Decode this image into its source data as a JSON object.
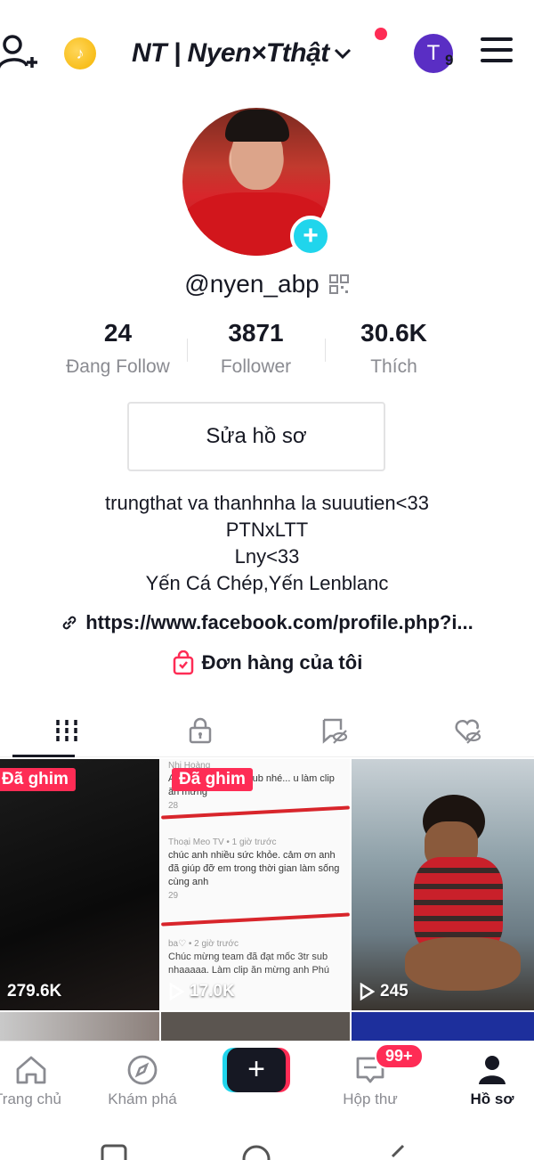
{
  "topbar": {
    "account_name": "NT | Nyen×Tthật",
    "avatar_initial": "T",
    "avatar_count": "9"
  },
  "profile": {
    "username": "@nyen_abp",
    "stats": [
      {
        "value": "24",
        "label": "Đang Follow"
      },
      {
        "value": "3871",
        "label": "Follower"
      },
      {
        "value": "30.6K",
        "label": "Thích"
      }
    ],
    "edit_label": "Sửa hồ sơ",
    "bio_lines": [
      "trungthat va thanhnha la suuutien<33",
      "PTNxLTT",
      "Lny<33",
      "Yến Cá Chép,Yến Lenblanc"
    ],
    "link": "https://www.facebook.com/profile.php?i...",
    "orders": "Đơn hàng của tôi"
  },
  "tabs": [
    "videos-tab",
    "private-tab",
    "reposts-tab",
    "liked-tab"
  ],
  "grid": {
    "videos": [
      {
        "pinned": "Đã ghim",
        "views": "279.6K"
      },
      {
        "pinned": "Đã ghim",
        "views": "17.0K"
      },
      {
        "pinned": "",
        "views": "245"
      }
    ],
    "comments": [
      {
        "meta": "Nhi Hoàng",
        "text": "APP đã đạt đc 3tr sub nhé... u làm clip ăn mừng"
      },
      {
        "meta": "Thoại Meo TV • 1 giờ trước",
        "text": "chúc anh nhiều sức khỏe. cảm ơn anh đã giúp đỡ em trong thời gian làm sống cùng anh"
      },
      {
        "meta": "ba♡ • 2 giờ trước",
        "text": "Chúc mừng team đã đạt mốc 3tr sub nhaaaaa. Làm clip ăn mừng anh Phú"
      }
    ],
    "comment_likes": [
      "28",
      "29"
    ]
  },
  "bottom_nav": {
    "home": "Trang chủ",
    "discover": "Khám phá",
    "create": "+",
    "inbox": "Hộp thư",
    "inbox_badge": "99+",
    "profile": "Hồ sơ"
  },
  "colors": {
    "accent_red": "#fe2c55",
    "accent_cyan": "#20d5ec",
    "text": "#161823",
    "muted": "#8a8b91"
  }
}
